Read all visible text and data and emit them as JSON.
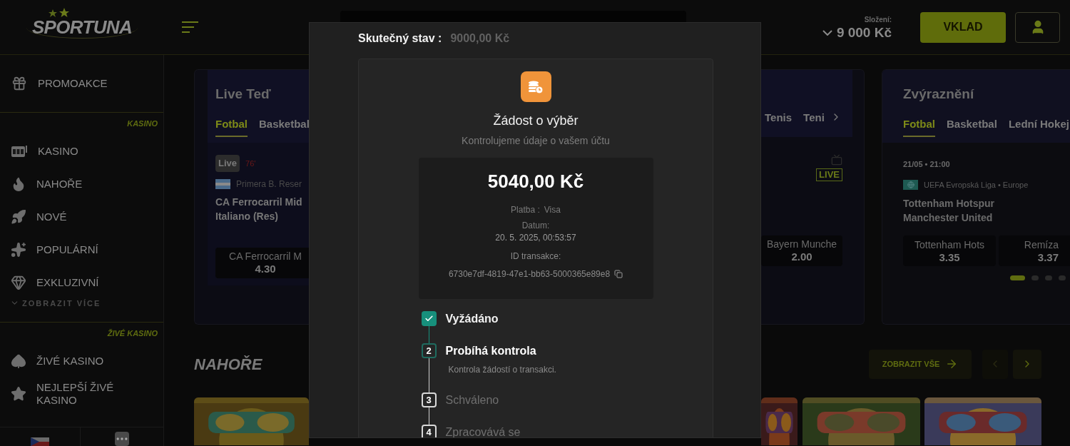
{
  "header": {
    "logo": "SPORTUNA",
    "balance_label": "Složení:",
    "balance_value": "9 000 Kč",
    "deposit_button": "VKLAD"
  },
  "sidebar": {
    "promo": "PROMOAKCE",
    "sections": [
      {
        "heading": "KASINO",
        "items": [
          "KASINO",
          "NAHOŘE",
          "NOVÉ",
          "POPULÁRNÍ",
          "EXKLUZIVNÍ"
        ],
        "more": "ZOBRAZIT VÍCE"
      },
      {
        "heading": "ŽIVÉ KASINO",
        "items": [
          "ŽIVÉ KASINO",
          "NEJLEPŠÍ ŽIVÉ KASINO"
        ]
      }
    ]
  },
  "live_card": {
    "title": "Live Teď",
    "tabs": [
      {
        "label": "Fotbal",
        "selected": true
      },
      {
        "label": "Basketbal",
        "selected": false
      }
    ],
    "live_badge": "Live",
    "minute": "76'",
    "league": "Primera B. Reser",
    "teams": [
      "CA Ferrocarril Mid",
      "Italiano (Res)"
    ],
    "odds": [
      {
        "label": "CA Ferrocarril M",
        "value": "4.30"
      }
    ]
  },
  "middle_card": {
    "tabs": [
      {
        "label": "Tenis",
        "selected": false
      },
      {
        "label": "Teni",
        "selected": false
      }
    ],
    "live_badge": "LIVE",
    "odds": [
      {
        "label": "Bayern Munche",
        "value": "2.00"
      }
    ]
  },
  "highlight_card": {
    "title": "Zvýraznění",
    "tabs": [
      {
        "label": "Fotbal",
        "selected": true
      },
      {
        "label": "Basketbal",
        "selected": false
      },
      {
        "label": "Lední Hokej",
        "selected": false
      }
    ],
    "time": "21/05 • 21:00",
    "league": "UEFA Evropská Liga • Europe",
    "teams": [
      "Tottenham Hotspur",
      "Manchester United"
    ],
    "odds": [
      {
        "label": "Tottenham Hots",
        "value": "3.35"
      },
      {
        "label": "Remíza",
        "value": "3.37"
      }
    ],
    "pager": [
      {
        "selected": true
      },
      {
        "selected": false
      },
      {
        "selected": false
      },
      {
        "selected": false
      }
    ]
  },
  "top_section": {
    "title": "NAHOŘE",
    "view_all": "ZOBRAZIT VŠE"
  },
  "modal": {
    "balance_label": "Skutečný stav :",
    "balance_value": "9000,00 Kč",
    "title": "Žádost o výběr",
    "subtitle": "Kontrolujeme údaje o vašem účtu",
    "amount": "5040,00 Kč",
    "payment_label": "Platba :",
    "payment_value": "Visa",
    "date_label": "Datum:",
    "date_value": "20. 5. 2025, 00:53:57",
    "id_label": "ID transakce:",
    "id_value": "6730e7df-4819-47e1-bb63-5000365e89e8",
    "steps": [
      {
        "completed": true,
        "active": false,
        "label": "Vyžádáno"
      },
      {
        "completed": false,
        "active": true,
        "number": "2",
        "label": "Probíhá kontrola",
        "description": "Kontrola žádostí o transakci."
      },
      {
        "completed": false,
        "active": false,
        "number": "3",
        "label": "Schváleno"
      },
      {
        "completed": false,
        "active": false,
        "number": "4",
        "label": "Zpracovává se"
      }
    ]
  }
}
